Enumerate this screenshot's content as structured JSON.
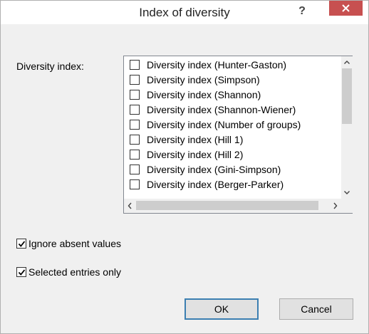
{
  "window": {
    "title": "Index of diversity",
    "help": "?"
  },
  "form": {
    "diversity_label": "Diversity index:",
    "indices": [
      "Diversity index (Hunter-Gaston)",
      "Diversity index (Simpson)",
      "Diversity index (Shannon)",
      "Diversity index (Shannon-Wiener)",
      "Diversity index (Number of groups)",
      "Diversity index (Hill 1)",
      "Diversity index (Hill 2)",
      "Diversity index (Gini-Simpson)",
      "Diversity index (Berger-Parker)"
    ],
    "ignore_absent_label": "Ignore absent values",
    "ignore_absent_checked": true,
    "selected_only_label": "Selected entries only",
    "selected_only_checked": true
  },
  "buttons": {
    "ok": "OK",
    "cancel": "Cancel"
  },
  "colors": {
    "close_button": "#c75050",
    "default_button_border": "#3c7fb1"
  }
}
